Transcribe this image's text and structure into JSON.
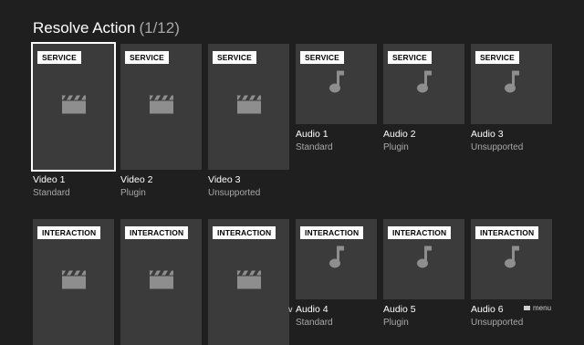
{
  "header": {
    "title": "Resolve Action",
    "count": "(1/12)"
  },
  "rows": [
    {
      "items": [
        {
          "badge": "SERVICE",
          "name": "Video 1",
          "type": "Standard",
          "media": "video",
          "icon": "clapperboard-icon",
          "selected": true
        },
        {
          "badge": "SERVICE",
          "name": "Video 2",
          "type": "Plugin",
          "media": "video",
          "icon": "clapperboard-icon"
        },
        {
          "badge": "SERVICE",
          "name": "Video 3",
          "type": "Unsupported",
          "media": "video",
          "icon": "clapperboard-icon"
        },
        {
          "badge": "SERVICE",
          "name": "Audio 1",
          "type": "Standard",
          "media": "audio",
          "icon": "music-note-icon"
        },
        {
          "badge": "SERVICE",
          "name": "Audio 2",
          "type": "Plugin",
          "media": "audio",
          "icon": "music-note-icon"
        },
        {
          "badge": "SERVICE",
          "name": "Audio 3",
          "type": "Unsupported",
          "media": "audio",
          "icon": "music-note-icon"
        }
      ]
    },
    {
      "items": [
        {
          "badge": "INTERACTION",
          "name": "",
          "type": "",
          "media": "video",
          "icon": "clapperboard-icon"
        },
        {
          "badge": "INTERACTION",
          "name": "",
          "type": "",
          "media": "video",
          "icon": "clapperboard-icon"
        },
        {
          "badge": "INTERACTION",
          "name": "",
          "type": "",
          "media": "video",
          "icon": "clapperboard-icon"
        },
        {
          "badge": "INTERACTION",
          "name": "Audio 4",
          "type": "Standard",
          "media": "audio",
          "icon": "music-note-icon"
        },
        {
          "badge": "INTERACTION",
          "name": "Audio 5",
          "type": "Plugin",
          "media": "audio",
          "icon": "music-note-icon"
        },
        {
          "badge": "INTERACTION",
          "name": "Audio 6",
          "type": "Unsupported",
          "media": "audio",
          "icon": "music-note-icon"
        }
      ]
    }
  ],
  "footer": {
    "menu_label": "menu",
    "more_icon": "chevron-down-icon"
  },
  "colors": {
    "background": "#1f1f1f",
    "tile": "#3b3b3b",
    "icon": "#8e8e8e",
    "subtext": "#a8a8a8",
    "focus": "#ffffff"
  }
}
